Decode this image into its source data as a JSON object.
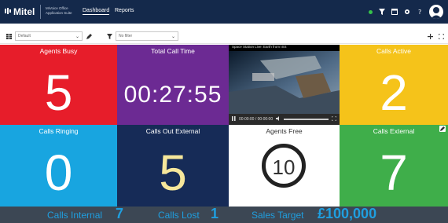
{
  "header": {
    "logo_text": "Mitel",
    "app_name": "MiVoice Office Application Suite",
    "nav": [
      "Dashboard",
      "Reports"
    ],
    "status_color": "#36c24a",
    "icons": [
      "status-dot",
      "filter-icon",
      "window-icon",
      "settings-icon",
      "help-icon",
      "user-avatar"
    ]
  },
  "toolbar": {
    "dashboard_select": "Default",
    "filter_select": "No filter"
  },
  "tiles": {
    "agents_busy": {
      "title": "Agents Busy",
      "value": "5",
      "color": "#e71d2a"
    },
    "total_call_time": {
      "title": "Total Call Time",
      "value": "00:27:55",
      "color": "#6c2a93"
    },
    "video": {
      "caption": "Space Station Live: Earth from ISS",
      "time": "00:00:00 / 00:00:00"
    },
    "calls_active": {
      "title": "Calls Active",
      "value": "2",
      "color": "#f5c31a"
    },
    "calls_ringing": {
      "title": "Calls Ringing",
      "value": "0",
      "color": "#18a5e0"
    },
    "calls_out_external": {
      "title": "Calls Out External",
      "value": "5",
      "color": "#162b57"
    },
    "agents_free": {
      "title": "Agents Free",
      "value": "10",
      "color": "#ffffff"
    },
    "calls_external": {
      "title": "Calls External",
      "value": "7",
      "color": "#3fae4a"
    }
  },
  "stats": {
    "calls_internal_label": "Calls Internal",
    "calls_internal_value": "7",
    "calls_lost_label": "Calls Lost",
    "calls_lost_value": "1",
    "sales_target_label": "Sales Target",
    "sales_target_value": "£100,000",
    "accent": "#1f9fe0"
  }
}
